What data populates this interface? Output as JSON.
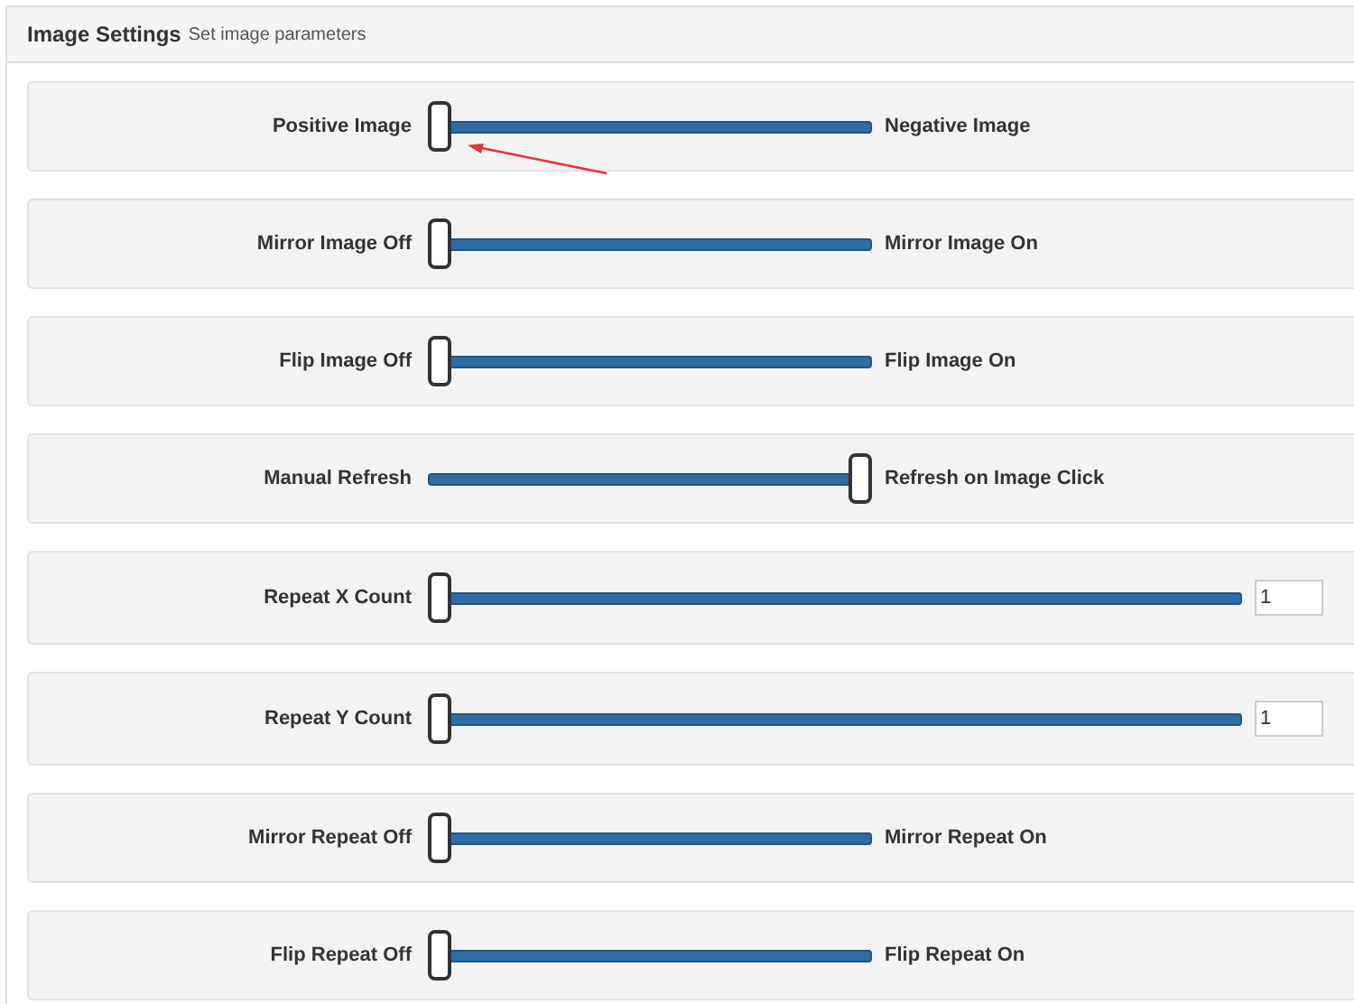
{
  "panel": {
    "title": "Image Settings",
    "subtitle": "Set image parameters"
  },
  "settings": [
    {
      "kind": "toggle",
      "left_label": "Positive Image",
      "right_label": "Negative Image",
      "level": 0
    },
    {
      "kind": "toggle",
      "left_label": "Mirror Image Off",
      "right_label": "Mirror Image On",
      "level": 0
    },
    {
      "kind": "toggle",
      "left_label": "Flip Image Off",
      "right_label": "Flip Image On",
      "level": 0
    },
    {
      "kind": "toggle",
      "left_label": "Manual Refresh",
      "right_label": "Refresh on Image Click",
      "level": 1
    },
    {
      "kind": "range",
      "left_label": "Repeat X Count",
      "value": "1",
      "level": 0
    },
    {
      "kind": "range",
      "left_label": "Repeat Y Count",
      "value": "1",
      "level": 0
    },
    {
      "kind": "toggle",
      "left_label": "Mirror Repeat Off",
      "right_label": "Mirror Repeat On",
      "level": 0
    },
    {
      "kind": "toggle",
      "left_label": "Flip Repeat Off",
      "right_label": "Flip Repeat On",
      "level": 0
    }
  ]
}
